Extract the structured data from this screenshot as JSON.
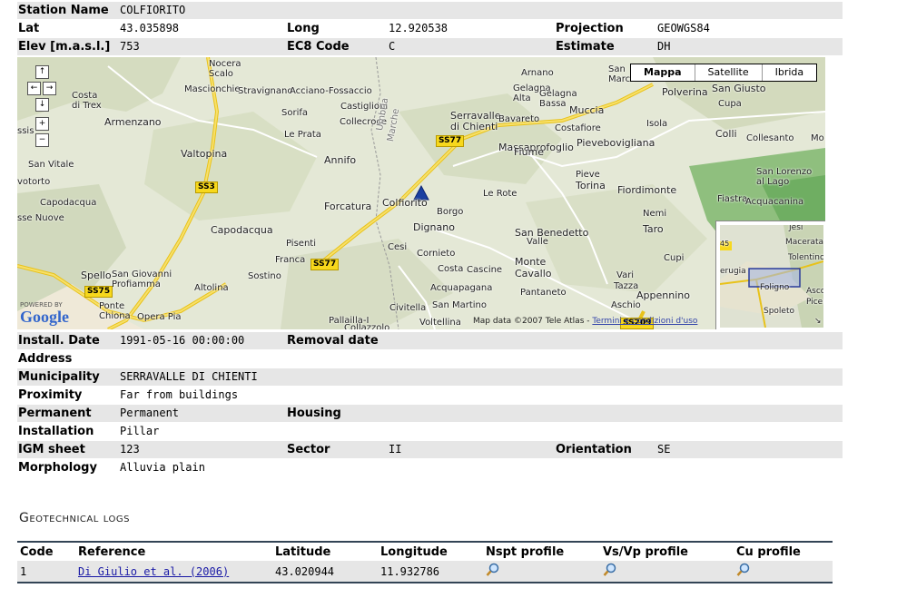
{
  "station": {
    "name_label": "Station Name",
    "name": "COLFIORITO",
    "lat_label": "Lat",
    "lat": "43.035898",
    "long_label": "Long",
    "long": "12.920538",
    "projection_label": "Projection",
    "projection": "GEOWGS84",
    "elev_label": "Elev [m.a.s.l.]",
    "elev": "753",
    "ec8_label": "EC8 Code",
    "ec8": "C",
    "estimate_label": "Estimate",
    "estimate": "DH",
    "install_label": "Install. Date",
    "install": "1991-05-16 00:00:00",
    "removal_label": "Removal date",
    "removal": "",
    "address_label": "Address",
    "address": "",
    "municipality_label": "Municipality",
    "municipality": "SERRAVALLE DI CHIENTI",
    "proximity_label": "Proximity",
    "proximity": "Far from buildings",
    "permanent_label": "Permanent",
    "permanent": "Permanent",
    "housing_label": "Housing",
    "housing": "",
    "installation_label": "Installation",
    "installation": "Pillar",
    "igm_label": "IGM sheet",
    "igm": "123",
    "sector_label": "Sector",
    "sector": "II",
    "orientation_label": "Orientation",
    "orientation": "SE",
    "morphology_label": "Morphology",
    "morphology": "Alluvia plain"
  },
  "map": {
    "type_buttons": [
      "Mappa",
      "Satellite",
      "Ibrida"
    ],
    "nav": {
      "up": "↑",
      "left": "←",
      "right": "→",
      "down": "↓",
      "zoom_in": "+",
      "zoom_out": "−"
    },
    "powered_by": "POWERED BY",
    "google": "Google",
    "copyright": "Map data ©2007 Tele Atlas -",
    "terms": "Termini e condizioni d'uso",
    "towns": [
      "Nocera",
      "Scalo",
      "Mascionchie",
      "Stravignano",
      "Acciano-Fossaccio",
      "Costa",
      "di Trex",
      "Sorifa",
      "Castiglioni",
      "Collecroce",
      "Armenzano",
      "Le Prata",
      "Umbria",
      "Marche",
      "Valtopina",
      "Annifo",
      "San Vitale",
      "votorto",
      "Capodacqua",
      "sse Nuove",
      "Capodacqua",
      "Forcatura",
      "Colfiorito",
      "Borgo",
      "Dignano",
      "Pisenti",
      "Cesi",
      "Cornieto",
      "Franca",
      "Sostino",
      "Costa",
      "Cascine",
      "Spello",
      "San Giovanni",
      "Profiamma",
      "Altolina",
      "Acquapagana",
      "Ponte",
      "Chiona",
      "Opera Pia",
      "Civitella",
      "San Martino",
      "Pallailla-I",
      "Collazzolo",
      "Voltellina",
      "Arnano",
      "Gelagna",
      "Alta",
      "Gelagna",
      "Bassa",
      "Serravalle",
      "di Chienti",
      "Bavareto",
      "Costafiore",
      "Massaprofoglio",
      "Muccia",
      "Pievebovigliana",
      "San",
      "Marcello",
      "Polverina",
      "San Giusto",
      "Isola",
      "Fiume",
      "Le Rote",
      "Pieve",
      "Torina",
      "Fiordimonte",
      "San Benedetto",
      "Valle",
      "Pantaneto",
      "Monte",
      "Cavallo",
      "Tazza",
      "Aschio",
      "Vari",
      "Appennino",
      "Nemi",
      "Taro",
      "Cupi",
      "Collesanto",
      "Colli",
      "Cupa",
      "Mo",
      "San Lorenzo",
      "al Lago",
      "Fiastra",
      "Acquacanina",
      "ssis"
    ],
    "roads": [
      "SS77",
      "SS3",
      "SS77",
      "SS75",
      "SS209"
    ],
    "overview_towns": [
      "Jesi",
      "Macerata",
      "Tolentino",
      "erugia",
      "Foligno",
      "Spoleto",
      "Ascol",
      "Picen"
    ],
    "overview_road": "45"
  },
  "geotech": {
    "title": "Geotechnical logs",
    "headers": [
      "Code",
      "Reference",
      "Latitude",
      "Longitude",
      "Nspt profile",
      "Vs/Vp profile",
      "Cu profile"
    ],
    "rows": [
      {
        "code": "1",
        "reference": "Di Giulio et al. (2006)",
        "latitude": "43.020944",
        "longitude": "11.932786"
      }
    ]
  },
  "colors": {
    "row_shade": "#e6e6e6",
    "link": "#1a1aa6",
    "marker": "#1a3fa0",
    "road": "#f7d81c"
  }
}
